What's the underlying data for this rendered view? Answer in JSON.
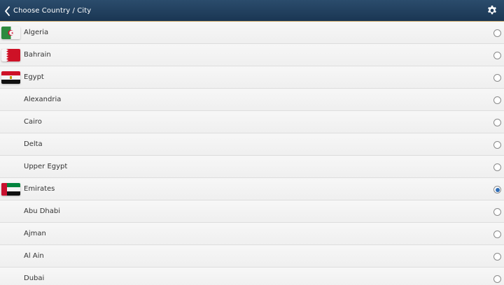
{
  "header": {
    "title": "Choose Country / City",
    "back_icon": "chevron-left-icon",
    "settings_icon": "gear-icon"
  },
  "colors": {
    "header_bg": "#1f3d5c",
    "header_border": "#c9a86a",
    "radio_selected": "#2f6db6"
  },
  "items": [
    {
      "label": "Algeria",
      "flag": "algeria-flag",
      "selected": false
    },
    {
      "label": "Bahrain",
      "flag": "bahrain-flag",
      "selected": false
    },
    {
      "label": "Egypt",
      "flag": "egypt-flag",
      "selected": false
    },
    {
      "label": "Alexandria",
      "flag": "",
      "selected": false
    },
    {
      "label": "Cairo",
      "flag": "",
      "selected": false
    },
    {
      "label": "Delta",
      "flag": "",
      "selected": false
    },
    {
      "label": "Upper Egypt",
      "flag": "",
      "selected": false
    },
    {
      "label": "Emirates",
      "flag": "emirates-flag",
      "selected": true
    },
    {
      "label": "Abu Dhabi",
      "flag": "",
      "selected": false
    },
    {
      "label": "Ajman",
      "flag": "",
      "selected": false
    },
    {
      "label": "Al Ain",
      "flag": "",
      "selected": false
    },
    {
      "label": "Dubai",
      "flag": "",
      "selected": false
    }
  ]
}
